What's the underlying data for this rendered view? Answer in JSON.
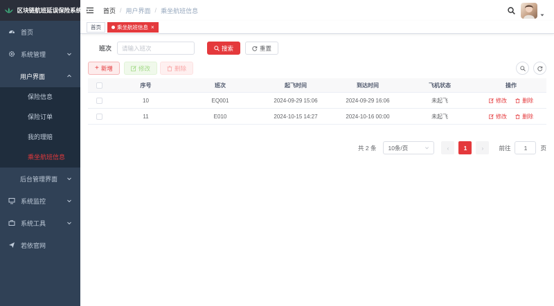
{
  "app": {
    "title": "区块链航班延误保险系统"
  },
  "sidebar": {
    "items": [
      {
        "label": "首页",
        "icon": "dashboard-icon"
      },
      {
        "label": "系统管理",
        "icon": "gear-icon"
      },
      {
        "label": "用户界面"
      },
      {
        "label": "后台管理界面"
      },
      {
        "label": "系统监控",
        "icon": "monitor-icon"
      },
      {
        "label": "系统工具",
        "icon": "toolbox-icon"
      },
      {
        "label": "若依官网",
        "icon": "send-icon"
      }
    ],
    "sub_items": [
      {
        "label": "保险信息"
      },
      {
        "label": "保险订单"
      },
      {
        "label": "我的理赔"
      },
      {
        "label": "乘坐航班信息",
        "active": true
      }
    ]
  },
  "breadcrumb": [
    "首页",
    "用户界面",
    "乘坐航班信息"
  ],
  "tags": [
    {
      "label": "首页"
    },
    {
      "label": "乘坐航班信息",
      "active": true
    }
  ],
  "search": {
    "label": "班次",
    "placeholder": "请输入班次",
    "search_label": "搜索",
    "reset_label": "重置"
  },
  "toolbar": {
    "add_label": "新增",
    "edit_label": "修改",
    "delete_label": "删除"
  },
  "table": {
    "headers": [
      "序号",
      "班次",
      "起飞时间",
      "到达时间",
      "飞机状态",
      "操作"
    ],
    "rows": [
      {
        "idx": "10",
        "flight": "EQ001",
        "depart": "2024-09-29 15:06",
        "arrive": "2024-09-29 16:06",
        "status": "未起飞",
        "edit": "修改",
        "delete": "删除"
      },
      {
        "idx": "11",
        "flight": "E010",
        "depart": "2024-10-15 14:27",
        "arrive": "2024-10-16 00:00",
        "status": "未起飞",
        "edit": "修改",
        "delete": "删除"
      }
    ]
  },
  "pagination": {
    "total": "共 2 条",
    "page_size": "10条/页",
    "current": "1",
    "goto_label": "前往",
    "goto_value": "1",
    "page_unit": "页"
  },
  "colors": {
    "accent": "#e4393c",
    "sidebar": "#304156",
    "submenu": "#1f2d3d"
  }
}
